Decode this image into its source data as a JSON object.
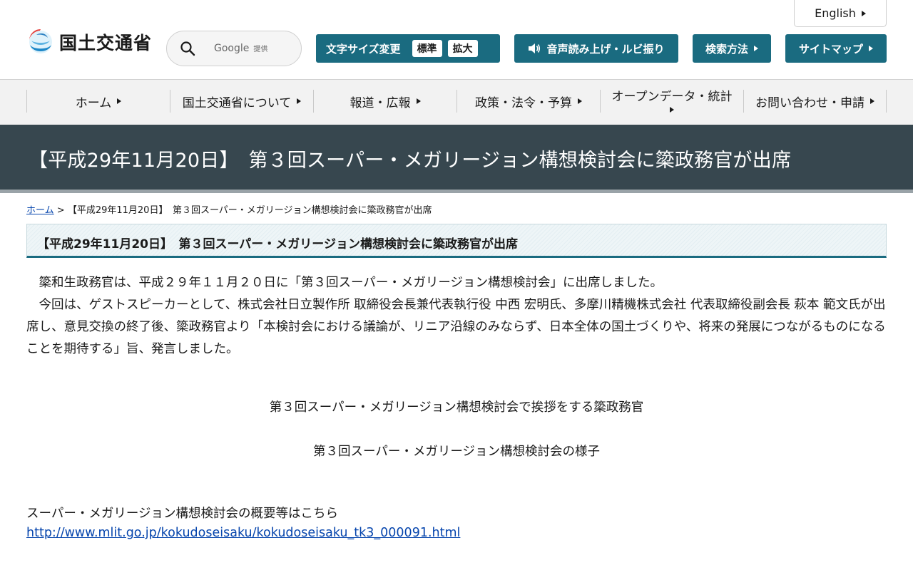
{
  "header": {
    "logo_text": "国土交通省",
    "search": {
      "placeholder": "Google",
      "provided_by": "提供"
    },
    "language_label": "English",
    "font_size": {
      "label": "文字サイズ変更",
      "options": [
        "標準",
        "拡大"
      ]
    },
    "voice_label": "音声読み上げ・ルビ振り",
    "search_method_label": "検索方法",
    "sitemap_label": "サイトマップ"
  },
  "global_nav": {
    "items": [
      {
        "label": "ホーム"
      },
      {
        "label": "国土交通省について"
      },
      {
        "label": "報道・広報"
      },
      {
        "label": "政策・法令・予算"
      },
      {
        "label": "オープンデータ・統計"
      },
      {
        "label": "お問い合わせ・申請"
      }
    ]
  },
  "page": {
    "title": "【平成29年11月20日】　第３回スーパー・メガリージョン構想検討会に簗政務官が出席",
    "breadcrumb": {
      "home": "ホーム",
      "separator": ">",
      "current": "【平成29年11月20日】　第３回スーパー・メガリージョン構想検討会に簗政務官が出席"
    },
    "section_heading": "【平成29年11月20日】　第３回スーパー・メガリージョン構想検討会に簗政務官が出席",
    "paragraphs": [
      "簗和生政務官は、平成２９年１１月２０日に「第３回スーパー・メガリージョン構想検討会」に出席しました。",
      "今回は、ゲストスピーカーとして、株式会社日立製作所 取締役会長兼代表執行役 中西 宏明氏、多摩川精機株式会社 代表取締役副会長 萩本 範文氏が出席し、意見交換の終了後、簗政務官より「本検討会における議論が、リニア沿線のみならず、日本全体の国土づくりや、将来の発展につながるものになることを期待する」旨、発言しました。"
    ],
    "captions": [
      "第３回スーパー・メガリージョン構想検討会で挨拶をする簗政務官",
      "第３回スーパー・メガリージョン構想検討会の様子"
    ],
    "more_info_label": "スーパー・メガリージョン構想検討会の概要等はこちら",
    "more_info_link": "http://www.mlit.go.jp/kokudoseisaku/kokudoseisaku_tk3_000091.html"
  },
  "colors": {
    "accent": "#1a6b80",
    "title_band": "#37474f",
    "link": "#0645ad",
    "nav_background": "#f2f2f2"
  },
  "icons": [
    "mlit-logo-icon",
    "search-icon",
    "caret-right-icon",
    "speaker-icon"
  ]
}
